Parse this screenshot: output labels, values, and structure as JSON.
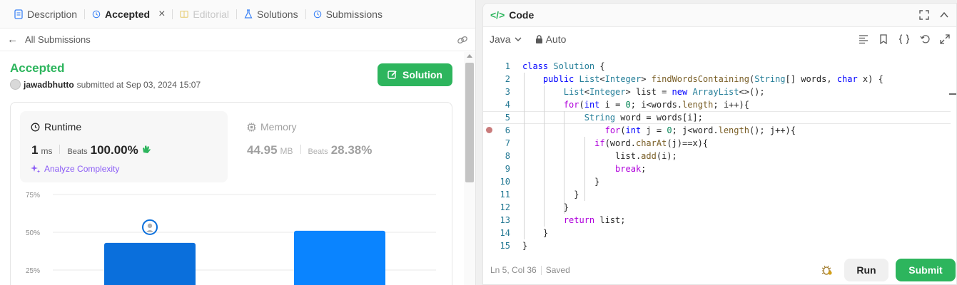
{
  "left_tabs": {
    "description": "Description",
    "accepted": "Accepted",
    "editorial": "Editorial",
    "solutions": "Solutions",
    "submissions": "Submissions"
  },
  "subheader": {
    "back_label": "All Submissions"
  },
  "submission": {
    "status": "Accepted",
    "username": "jawadbhutto",
    "submitted_text": "submitted at Sep 03, 2024 15:07",
    "solution_button": "Solution"
  },
  "runtime": {
    "title": "Runtime",
    "value": "1",
    "unit": "ms",
    "beats_label": "Beats",
    "beats_value": "100.00%",
    "analyze_label": "Analyze Complexity"
  },
  "memory": {
    "title": "Memory",
    "value": "44.95",
    "unit": "MB",
    "beats_label": "Beats",
    "beats_value": "28.38%"
  },
  "chart_data": {
    "type": "bar",
    "ytick_labels": [
      "75%",
      "50%",
      "25%"
    ],
    "ylim": [
      0,
      75
    ],
    "values": [
      43,
      51
    ],
    "user_bar_index": 0,
    "colors": [
      "#0a6fdc",
      "#0a84ff"
    ]
  },
  "code_panel": {
    "title": "Code",
    "language": "Java",
    "mode": "Auto"
  },
  "code_lines": [
    "class Solution {",
    "    public List<Integer> findWordsContaining(String[] words, char x) {",
    "        List<Integer> list = new ArrayList<>();",
    "        for(int i = 0; i<words.length; i++){",
    "            String word = words[i];",
    "                for(int j = 0; j<word.length(); j++){",
    "              if(word.charAt(j)==x){",
    "                  list.add(i);",
    "                  break;",
    "              }",
    "          }",
    "        }",
    "        return list;",
    "    }",
    "}"
  ],
  "footer": {
    "cursor": "Ln 5, Col 36",
    "saved": "Saved",
    "run_label": "Run",
    "submit_label": "Submit"
  }
}
